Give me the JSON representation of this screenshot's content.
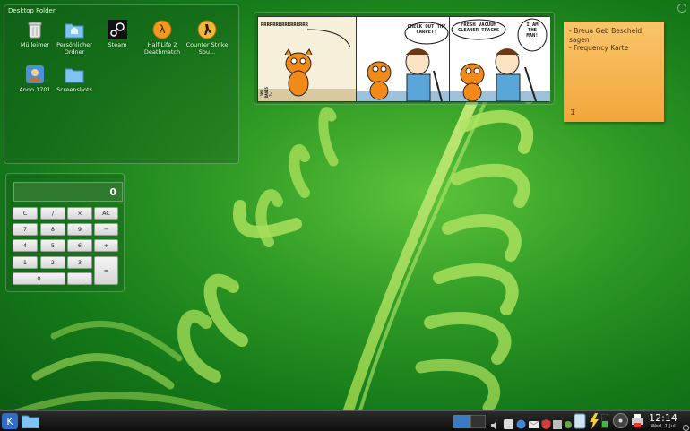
{
  "desktop_folder": {
    "title": "Desktop Folder",
    "icons": [
      {
        "label": "Mülleimer",
        "icon": "trash-icon"
      },
      {
        "label": "Persönlicher Ordner",
        "icon": "home-folder-icon"
      },
      {
        "label": "Steam",
        "icon": "steam-icon"
      },
      {
        "label": "Half-Life 2 Deathmatch",
        "icon": "half-life-icon"
      },
      {
        "label": "Counter Strike Sou...",
        "icon": "counter-strike-icon"
      },
      {
        "label": "Anno 1701",
        "icon": "anno-icon"
      },
      {
        "label": "Screenshots",
        "icon": "folder-icon"
      }
    ]
  },
  "calculator": {
    "display": "0",
    "keys": {
      "c": "C",
      "div": "/",
      "mul": "×",
      "ac": "AC",
      "k7": "7",
      "k8": "8",
      "k9": "9",
      "minus": "−",
      "k4": "4",
      "k5": "5",
      "k6": "6",
      "plus": "+",
      "k1": "1",
      "k2": "2",
      "k3": "3",
      "eq": "=",
      "k0": "0",
      "dot": "."
    }
  },
  "comic": {
    "panel1_text": "RRRRRRRRRRRRRRRR",
    "panel1_signature": "JPM DAVIS 7-1",
    "panel2_text": "CHECK OUT THE CARPET!",
    "panel3_text_left": "FRESH VACUUM CLEANER TRACKS",
    "panel3_text_right": "I AM THE MAN!"
  },
  "sticky_note": {
    "lines": [
      "- Breua Geb Bescheid",
      "sagen",
      "- Frequency Karte"
    ]
  },
  "taskbar": {
    "time": "12:14",
    "date": "Wed, 1 Jul",
    "launcher_icon": "kde-menu-icon",
    "folder_icon": "folder-icon"
  },
  "colors": {
    "wallpaper": "#2f9a25",
    "note": "#f2a63c",
    "taskbar": "#111111"
  }
}
